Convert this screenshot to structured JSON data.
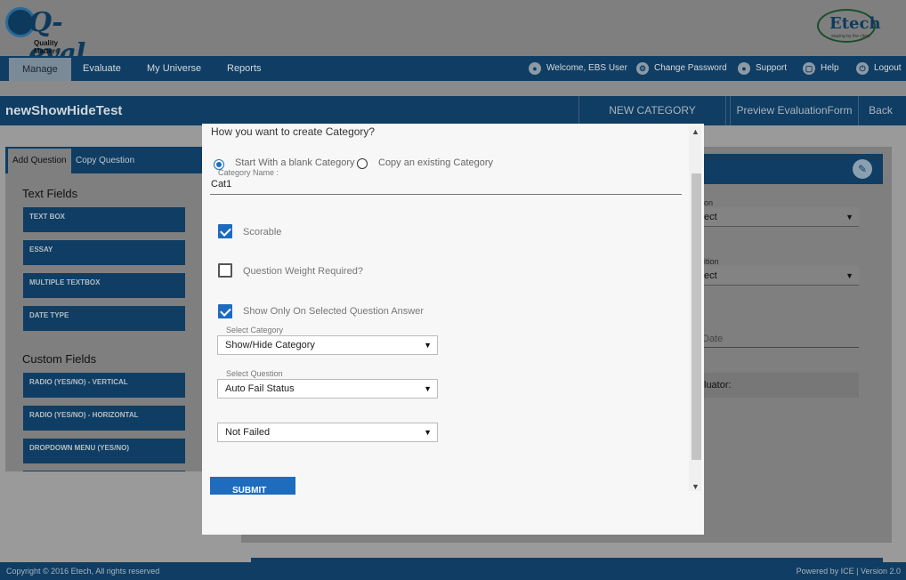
{
  "header": {
    "logo_left": {
      "name": "Q-eval",
      "tagline": "Quality Matters"
    },
    "logo_right": {
      "name": "Etech",
      "tagline": "staying by the client"
    }
  },
  "nav": {
    "items": [
      "Manage",
      "Evaluate",
      "My Universe",
      "Reports"
    ],
    "right": {
      "welcome": "Welcome, EBS User",
      "change_password": "Change Password",
      "support": "Support",
      "help": "Help",
      "logout": "Logout"
    }
  },
  "titlebar": {
    "title": "newShowHideTest",
    "new_category": "NEW CATEGORY",
    "preview": "Preview EvaluationForm",
    "back": "Back"
  },
  "left_panel": {
    "tabs": [
      "Add Question",
      "Copy Question"
    ],
    "text_fields_heading": "Text Fields",
    "text_fields": [
      "TEXT BOX",
      "ESSAY",
      "MULTIPLE TEXTBOX",
      "DATE TYPE"
    ],
    "custom_fields_heading": "Custom Fields",
    "custom_fields": [
      "RADIO (YES/NO) - VERTICAL",
      "RADIO (YES/NO) - HORIZONTAL",
      "DROPDOWN MENU (YES/NO)"
    ]
  },
  "right_panel": {
    "field1_label": "on",
    "field1_value": "ect",
    "field2_label": "ition",
    "field2_value": "ect",
    "date_placeholder": "Date",
    "evaluator_text": "luator:"
  },
  "modal": {
    "question": "How you want to create Category?",
    "option_blank": "Start With a blank Category",
    "option_copy": "Copy an existing Category",
    "category_name_label": "Category Name :",
    "category_name_value": "Cat1",
    "scorable_label": "Scorable",
    "scorable_checked": true,
    "weight_label": "Question Weight Required?",
    "weight_checked": false,
    "show_only_label": "Show Only On Selected Question Answer",
    "show_only_checked": true,
    "select_category_label": "Select Category",
    "select_category_value": "Show/Hide Category",
    "select_question_label": "Select Question",
    "select_question_value": "Auto Fail Status",
    "answer_value": "Not Failed",
    "submit_label": "SUBMIT"
  },
  "footer": {
    "copyright": "Copyright © 2016 Etech, All rights reserved",
    "powered": "Powered by ICE | Version 2.0"
  }
}
